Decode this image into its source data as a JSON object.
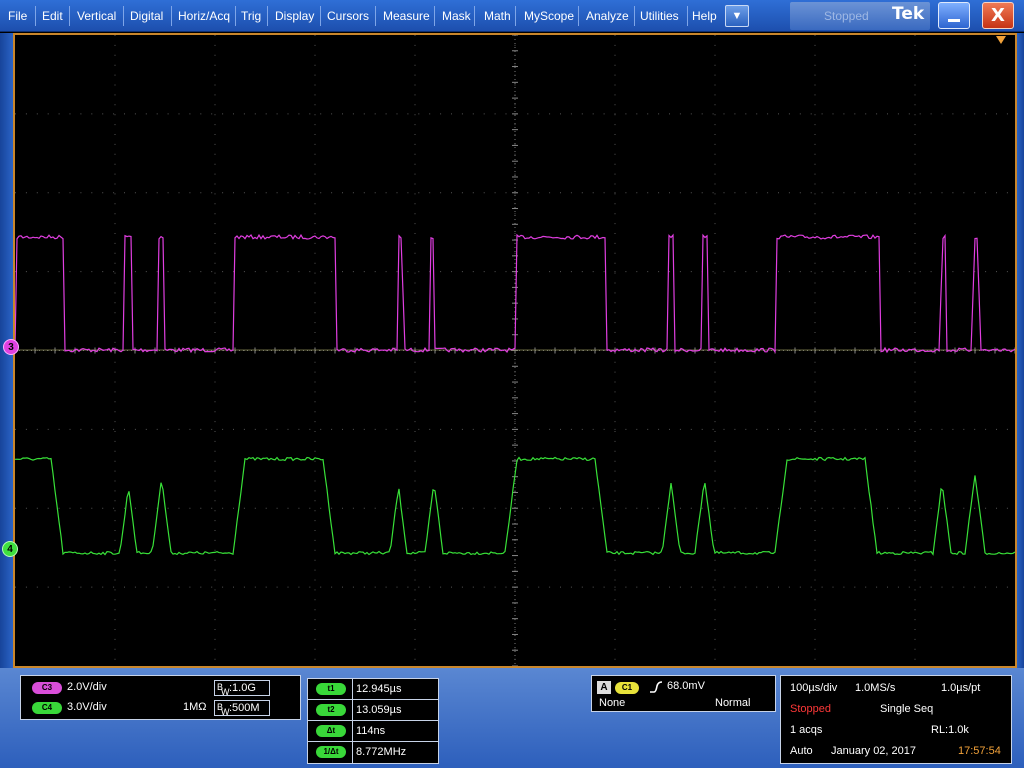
{
  "menu": {
    "items": [
      "File",
      "Edit",
      "Vertical",
      "Digital",
      "Horiz/Acq",
      "Trig",
      "Display",
      "Cursors",
      "Measure",
      "Mask",
      "Math",
      "MyScope",
      "Analyze",
      "Utilities",
      "Help"
    ],
    "dropdown_icon": "▼",
    "brand_shadow": "Stopped",
    "brand": "Tek",
    "close_icon": "X"
  },
  "channel_markers": {
    "ch3": "3",
    "ch4": "4"
  },
  "vertical": {
    "c3": {
      "label": "C3",
      "scale": "2.0V/div",
      "bw_prefix_b": "B",
      "bw_prefix_w": "W",
      "bw": ":1.0G"
    },
    "c4": {
      "label": "C4",
      "scale": "3.0V/div",
      "impedance": "1MΩ",
      "bw_prefix_b": "B",
      "bw_prefix_w": "W",
      "bw": ":500M"
    }
  },
  "cursors": {
    "rows": [
      {
        "label": "t1",
        "value": "12.945µs"
      },
      {
        "label": "t2",
        "value": "13.059µs"
      },
      {
        "label": "Δt",
        "value": "114ns"
      },
      {
        "label": "1/Δt",
        "value": "8.772MHz"
      }
    ]
  },
  "trigger": {
    "label_a": "A",
    "source": "C1",
    "slope_icon": "rising-edge-icon",
    "level": "68.0mV",
    "coupling": "None",
    "mode": "Normal"
  },
  "acquisition": {
    "timebase": "100µs/div",
    "sample_rate": "1.0MS/s",
    "resolution": "1.0µs/pt",
    "state": "Stopped",
    "seq_mode": "Single Seq",
    "acqs": "1 acqs",
    "record_length": "RL:1.0k",
    "trigger_mode": "Auto",
    "date": "January 02, 2017",
    "time": "17:57:54"
  },
  "colors": {
    "ch3_trace": "#e03ee0",
    "ch4_trace": "#38e038",
    "graticule_border": "#c9862b",
    "stopped": "#ff3838",
    "time": "#f2a23a"
  }
}
